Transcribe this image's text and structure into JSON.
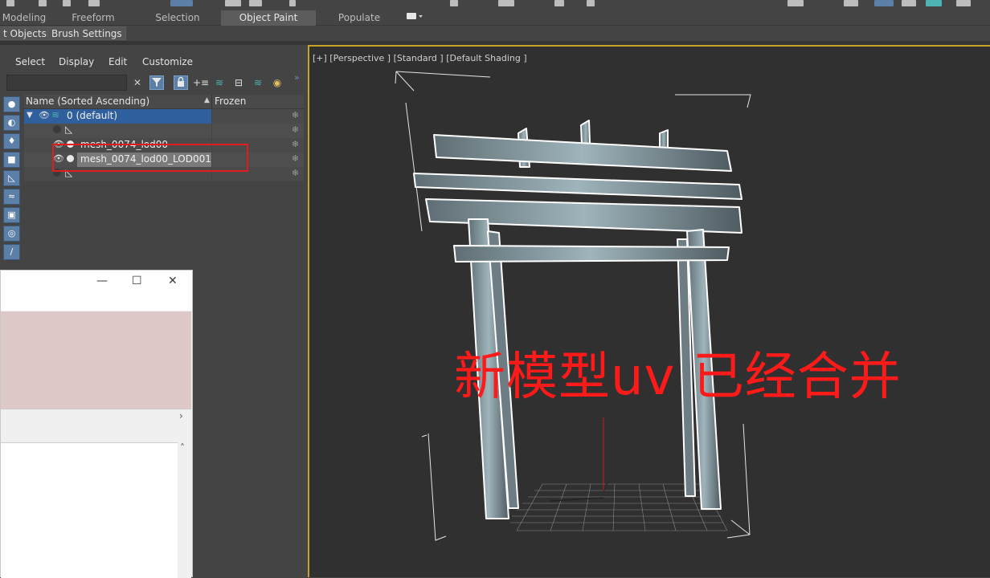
{
  "ribbon": {
    "tabs": [
      "Modeling",
      "Freeform",
      "Selection",
      "Object Paint",
      "Populate"
    ],
    "active_tab": "Object Paint"
  },
  "subtabs": [
    "t Objects",
    "Brush Settings"
  ],
  "scene_explorer": {
    "menu": [
      "Select",
      "Display",
      "Edit",
      "Customize"
    ],
    "columns": {
      "name": "Name (Sorted Ascending)",
      "frozen": "Frozen"
    },
    "rows": [
      {
        "label": "0 (default)",
        "type": "layer"
      },
      {
        "label": "",
        "type": "bone"
      },
      {
        "label": "mesh_0074_lod00",
        "type": "mesh"
      },
      {
        "label": "mesh_0074_lod00_LOD001",
        "type": "mesh"
      },
      {
        "label": "",
        "type": "bone"
      }
    ]
  },
  "viewport": {
    "label": "[+] [Perspective ] [Standard ] [Default Shading ]",
    "annotation": "新模型uv 已经合并"
  },
  "colors": {
    "accent": "#c9a227",
    "annotation_red": "#ff1a1a",
    "highlight_box": "#e11c1c",
    "layer_row": "#2f5f9c"
  }
}
